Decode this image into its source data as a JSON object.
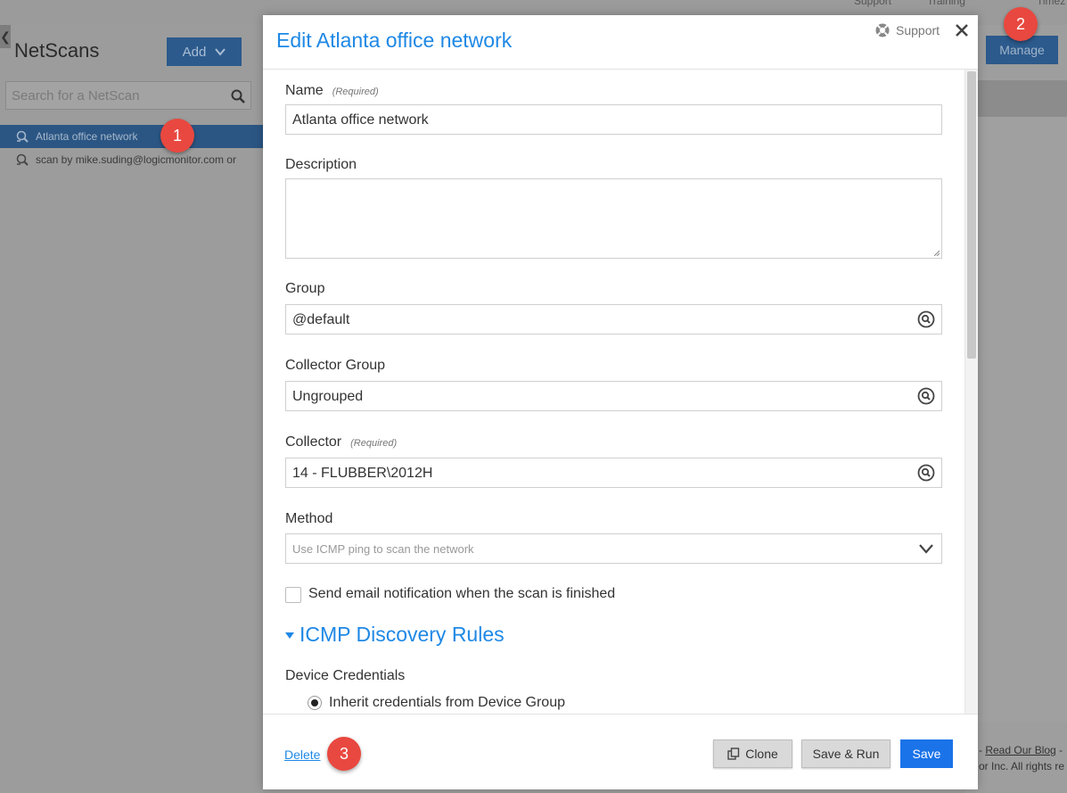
{
  "background": {
    "top_links": [
      "Support",
      "Training",
      "Timez"
    ],
    "netscans_title": "NetScans",
    "add_label": "Add",
    "search_placeholder": "Search for a NetScan",
    "list_items": [
      {
        "label": "Atlanta office network",
        "selected": true
      },
      {
        "label": "scan by mike.suding@logicmonitor.com or",
        "selected": false
      }
    ],
    "manage_label": "Manage",
    "bottom_links": {
      "prefix": "-",
      "blog": "Read Our Blog",
      "suffix": "-",
      "copyright": "or Inc. All rights re"
    }
  },
  "annotations": [
    "1",
    "2",
    "3"
  ],
  "modal": {
    "title": "Edit Atlanta office network",
    "support_label": "Support",
    "fields": {
      "name": {
        "label": "Name",
        "required": "(Required)",
        "value": "Atlanta office network"
      },
      "description": {
        "label": "Description",
        "value": ""
      },
      "group": {
        "label": "Group",
        "value": "@default"
      },
      "collector_group": {
        "label": "Collector Group",
        "value": "Ungrouped"
      },
      "collector": {
        "label": "Collector",
        "required": "(Required)",
        "value": "14 - FLUBBER\\2012H"
      },
      "method": {
        "label": "Method",
        "value": "Use ICMP ping to scan the network"
      }
    },
    "email_notification": {
      "label": "Send email notification when the scan is finished",
      "checked": false
    },
    "section_title": "ICMP Discovery Rules",
    "credentials": {
      "label": "Device Credentials",
      "option": "Inherit credentials from Device Group",
      "selected": true
    },
    "footer": {
      "delete": "Delete",
      "clone": "Clone",
      "save_run": "Save & Run",
      "save": "Save"
    }
  },
  "colors": {
    "accent": "#1e88e5",
    "primary_button": "#1a73e8",
    "badge": "#e8483f"
  }
}
